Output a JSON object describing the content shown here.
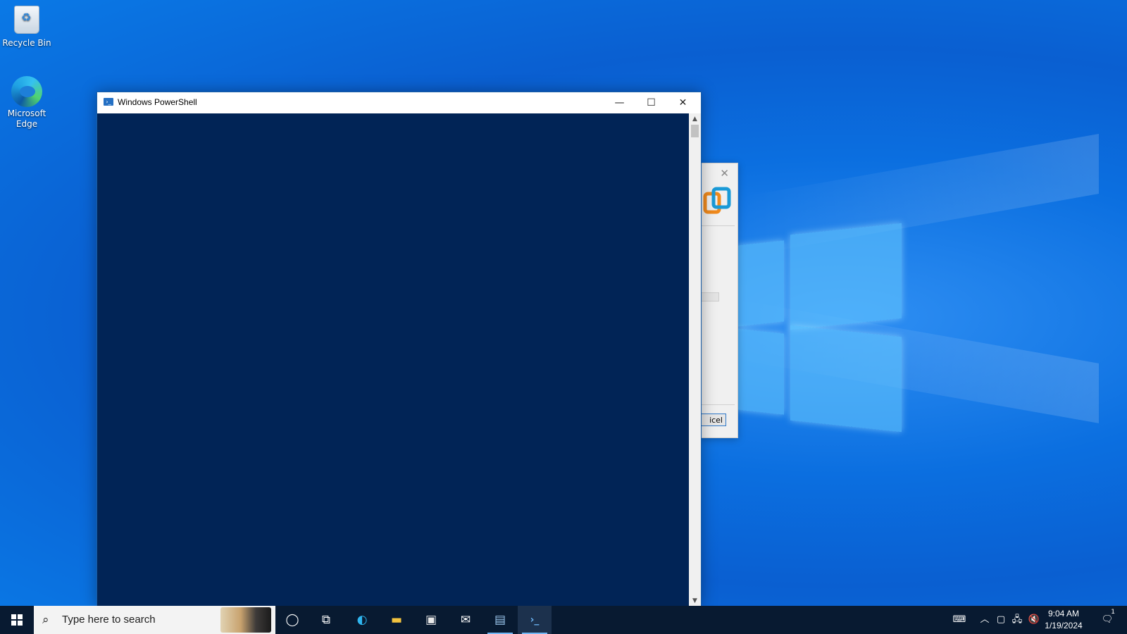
{
  "desktop": {
    "icons": [
      {
        "label": "Recycle Bin"
      },
      {
        "label_line1": "Microsoft",
        "label_line2": "Edge"
      }
    ]
  },
  "powershell": {
    "title": "Windows PowerShell",
    "controls": {
      "minimize": "—",
      "maximize": "☐",
      "close": "✕"
    },
    "scroll": {
      "up": "▲",
      "down": "▼"
    }
  },
  "bg_dialog": {
    "close": "✕",
    "button_partial": "icel"
  },
  "taskbar": {
    "search_placeholder": "Type here to search",
    "search_icon": "⌕",
    "apps": [
      {
        "name": "cortana-icon",
        "glyph": "◯"
      },
      {
        "name": "task-view-icon",
        "glyph": "⧉"
      },
      {
        "name": "edge-icon",
        "glyph": "◐"
      },
      {
        "name": "file-explorer-icon",
        "glyph": "▬"
      },
      {
        "name": "store-icon",
        "glyph": "▣"
      },
      {
        "name": "mail-icon",
        "glyph": "✉"
      },
      {
        "name": "installer-icon",
        "glyph": "▤"
      },
      {
        "name": "powershell-icon",
        "glyph": "›_"
      }
    ],
    "tray": {
      "keyboard": "⌨",
      "chevron": "︿",
      "meet": "▢",
      "network": "🖧",
      "volume": "🔇",
      "notifications": "🗨",
      "notification_count": "1"
    },
    "clock": {
      "time": "9:04 AM",
      "date": "1/19/2024"
    }
  },
  "colors": {
    "console_bg": "#012456",
    "taskbar_bg": "#081a31",
    "accent": "#73b8f5"
  }
}
